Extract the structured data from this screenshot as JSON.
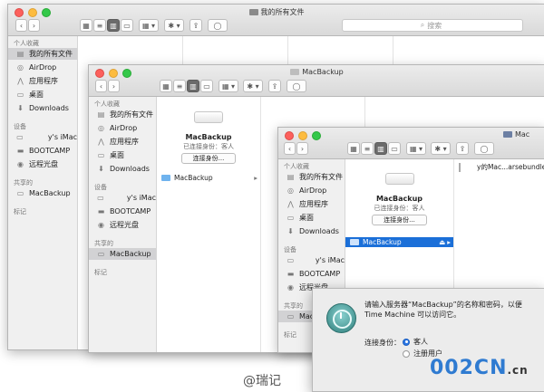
{
  "sidebar": {
    "favorites_header": "个人收藏",
    "devices_header": "设备",
    "shared_header": "共享的",
    "tags_header": "标记",
    "favorites": [
      {
        "label": "我的所有文件",
        "icon": "all-files-icon"
      },
      {
        "label": "AirDrop",
        "icon": "airdrop-icon"
      },
      {
        "label": "应用程序",
        "icon": "applications-icon"
      },
      {
        "label": "桌面",
        "icon": "desktop-icon"
      },
      {
        "label": "Downloads",
        "icon": "downloads-icon"
      }
    ],
    "devices": [
      {
        "label": "y's iMac",
        "icon": "imac-icon"
      },
      {
        "label": "BOOTCAMP",
        "icon": "disk-icon"
      },
      {
        "label": "远程光盘",
        "icon": "remote-disc-icon"
      }
    ],
    "shared": [
      {
        "label": "MacBackup",
        "icon": "network-server-icon"
      }
    ],
    "shared_truncated": "Mac"
  },
  "toolbar": {
    "back": "‹",
    "forward": "›",
    "view_icons": "▦",
    "view_list": "≡",
    "view_columns": "▥",
    "view_coverflow": "▭",
    "arrange": "▦ ▾",
    "action": "✱ ▾",
    "share": "⇪",
    "tags": "◯",
    "search_placeholder": "搜索"
  },
  "windows": {
    "win1": {
      "title": "我的所有文件"
    },
    "win2": {
      "title": "MacBackup"
    },
    "win3": {
      "title": "Mac"
    }
  },
  "server_panel": {
    "name": "MacBackup",
    "status": "已连接身份：客人",
    "connect_button": "连接身份..."
  },
  "columns": {
    "share_item": "MacBackup",
    "bundle_item": "y的Mac...arsebundle",
    "arrow": "▸",
    "eject": "⏏"
  },
  "dialog": {
    "prompt_line1": "请输入服务器“MacBackup”的名称和密码，以便",
    "prompt_line2": "Time Machine 可以访问它。",
    "connect_as_label": "连接身份：",
    "options": [
      {
        "label": "客人",
        "selected": true
      },
      {
        "label": "注册用户",
        "selected": false
      }
    ]
  },
  "watermarks": {
    "weibo": "@瑞记",
    "site": "002CN",
    "site_suffix": ".cn"
  },
  "colors": {
    "selection_blue": "#1b6fd8",
    "folder_blue": "#6fb3ee",
    "radio_blue": "#2c77e5"
  }
}
